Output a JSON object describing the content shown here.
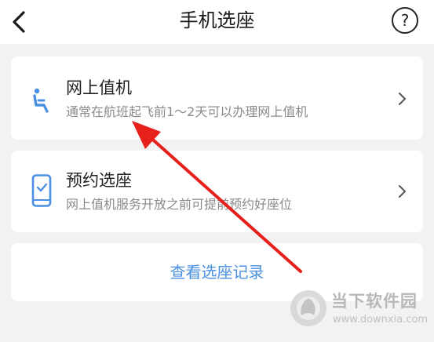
{
  "header": {
    "back_icon": "chevron-left-icon",
    "title": "手机选座",
    "help_label": "?"
  },
  "cards": {
    "checkin": {
      "icon": "seat-icon",
      "title": "网上值机",
      "description": "通常在航班起飞前1～2天可以办理网上值机"
    },
    "reserve": {
      "icon": "phone-check-icon",
      "title": "预约选座",
      "description": "网上值机服务开放之前可提前预约好座位"
    },
    "history": {
      "link_label": "查看选座记录"
    }
  },
  "watermark": {
    "name": "当下软件园",
    "url": "www.downxia.com"
  },
  "colors": {
    "accent": "#4a90e2",
    "annotation_arrow": "#e8201c",
    "background": "#f2f2f2",
    "card": "#ffffff"
  }
}
